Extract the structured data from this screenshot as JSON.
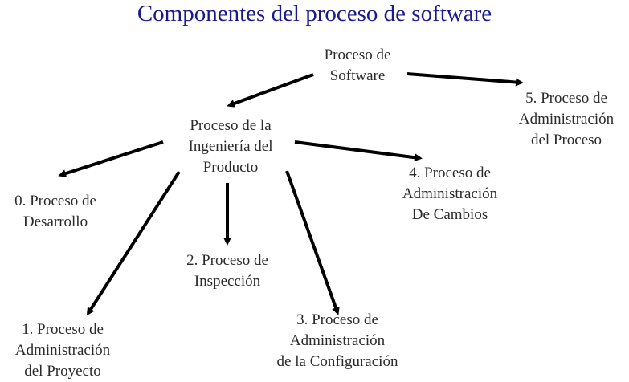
{
  "title": "Componentes del proceso de software",
  "colors": {
    "title": "#1a1a8c",
    "text": "#2b2b2b",
    "arrow": "#000000"
  },
  "nodes": {
    "root": [
      "Proceso de",
      "Software"
    ],
    "ingenieria": [
      "Proceso de la",
      "Ingeniería del",
      "Producto"
    ],
    "p0": [
      "0. Proceso de",
      "Desarrollo"
    ],
    "p1": [
      "1. Proceso de",
      "Administración",
      "del Proyecto"
    ],
    "p2": [
      "2. Proceso de",
      "Inspección"
    ],
    "p3": [
      "3. Proceso de",
      "Administración",
      "de la Configuración"
    ],
    "p4": [
      "4. Proceso de",
      "Administración",
      "De Cambios"
    ],
    "p5": [
      "5. Proceso de",
      "Administración",
      "del Proceso"
    ]
  },
  "edges": [
    [
      "root",
      "ingenieria"
    ],
    [
      "root",
      "p5"
    ],
    [
      "ingenieria",
      "p0"
    ],
    [
      "ingenieria",
      "p1"
    ],
    [
      "ingenieria",
      "p2"
    ],
    [
      "ingenieria",
      "p3"
    ],
    [
      "ingenieria",
      "p4"
    ]
  ]
}
